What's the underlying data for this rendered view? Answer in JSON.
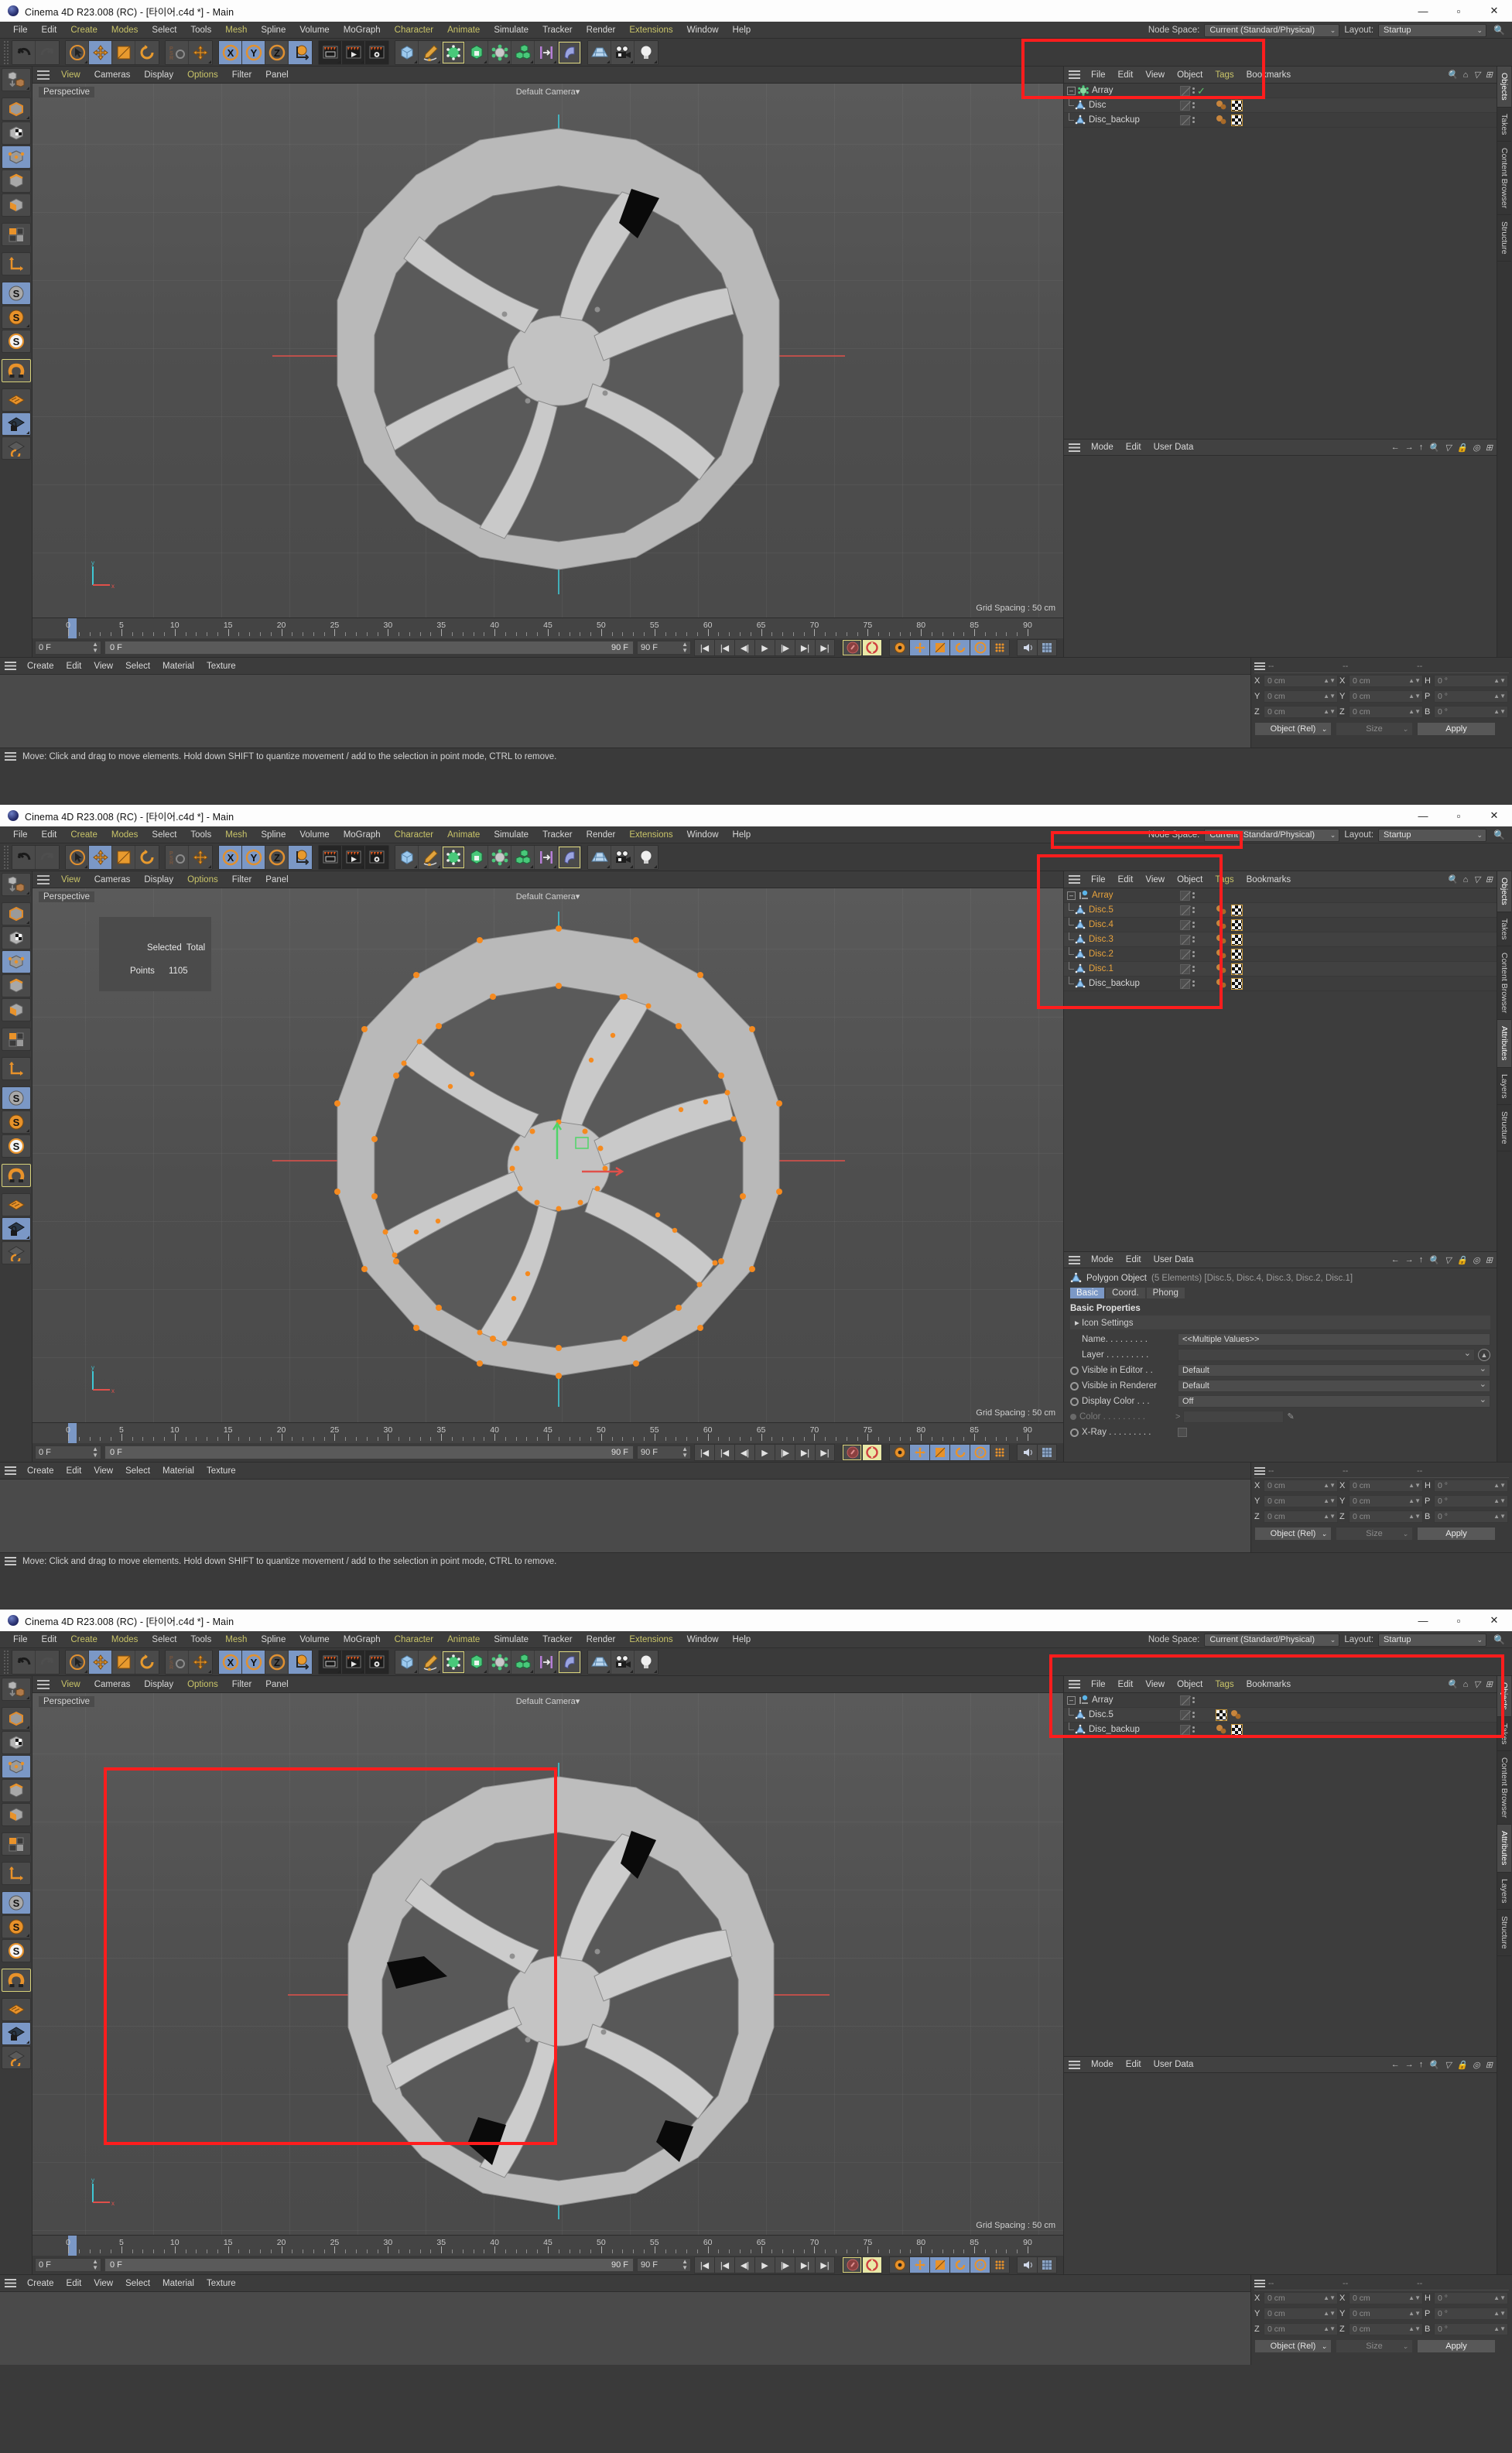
{
  "app": {
    "title": "Cinema 4D R23.008 (RC) - [타이어.c4d *] - Main",
    "win_min": "—",
    "win_max": "▫",
    "win_close": "✕"
  },
  "menu": {
    "items": [
      {
        "label": "File",
        "accent": false
      },
      {
        "label": "Edit",
        "accent": false
      },
      {
        "label": "Create",
        "accent": true
      },
      {
        "label": "Modes",
        "accent": true
      },
      {
        "label": "Select",
        "accent": false
      },
      {
        "label": "Tools",
        "accent": false
      },
      {
        "label": "Mesh",
        "accent": false
      },
      {
        "label": "Spline",
        "accent": false
      },
      {
        "label": "Volume",
        "accent": false
      },
      {
        "label": "MoGraph",
        "accent": false
      },
      {
        "label": "Character",
        "accent": false
      },
      {
        "label": "Animate",
        "accent": true
      },
      {
        "label": "Simulate",
        "accent": false
      },
      {
        "label": "Tracker",
        "accent": false
      },
      {
        "label": "Render",
        "accent": false
      },
      {
        "label": "Extensions",
        "accent": true
      },
      {
        "label": "Window",
        "accent": false
      },
      {
        "label": "Help",
        "accent": false
      }
    ],
    "node_space_label": "Node Space:",
    "node_space_value": "Current (Standard/Physical)",
    "layout_label": "Layout:",
    "layout_value": "Startup"
  },
  "viewport": {
    "menu": [
      {
        "label": "View",
        "accent": true
      },
      {
        "label": "Cameras",
        "accent": false
      },
      {
        "label": "Display",
        "accent": false
      },
      {
        "label": "Options",
        "accent": true
      },
      {
        "label": "Filter",
        "accent": false
      },
      {
        "label": "Panel",
        "accent": false
      }
    ],
    "perspective": "Perspective",
    "camera": "Default Camera▾",
    "grid_spacing": "Grid Spacing : 50 cm",
    "tooltip_header": "Selected  Total",
    "tooltip_label": "Points",
    "tooltip_value": "1105"
  },
  "object_manager": {
    "menu": [
      {
        "label": "File",
        "accent": false
      },
      {
        "label": "Edit",
        "accent": false
      },
      {
        "label": "View",
        "accent": false
      },
      {
        "label": "Object",
        "accent": false
      },
      {
        "label": "Tags",
        "accent": true
      },
      {
        "label": "Bookmarks",
        "accent": false
      }
    ],
    "panel_1_items": [
      {
        "name": "Array",
        "depth": 0,
        "icon": "array-icon",
        "selected": false,
        "tags": [
          "check"
        ]
      },
      {
        "name": "Disc",
        "depth": 1,
        "icon": "polygon-icon",
        "selected": false,
        "tags": [
          "phong",
          "checker"
        ]
      },
      {
        "name": "Disc_backup",
        "depth": 0,
        "icon": "polygon-icon",
        "selected": false,
        "tags": [
          "phong",
          "checker"
        ]
      }
    ],
    "panel_2_items": [
      {
        "name": "Array",
        "depth": 0,
        "icon": "array-icon",
        "selected": true,
        "tags": []
      },
      {
        "name": "Disc.5",
        "depth": 1,
        "icon": "polygon-icon",
        "selected": true,
        "tags": [
          "phong",
          "checker"
        ]
      },
      {
        "name": "Disc.4",
        "depth": 1,
        "icon": "polygon-icon",
        "selected": true,
        "tags": [
          "phong",
          "checker"
        ]
      },
      {
        "name": "Disc.3",
        "depth": 1,
        "icon": "polygon-icon",
        "selected": true,
        "tags": [
          "phong",
          "checker"
        ]
      },
      {
        "name": "Disc.2",
        "depth": 1,
        "icon": "polygon-icon",
        "selected": true,
        "tags": [
          "phong",
          "checker"
        ]
      },
      {
        "name": "Disc.1",
        "depth": 1,
        "icon": "polygon-icon",
        "selected": true,
        "tags": [
          "phong",
          "checker"
        ]
      },
      {
        "name": "Disc_backup",
        "depth": 0,
        "icon": "polygon-icon",
        "selected": false,
        "tags": [
          "phong",
          "checker"
        ]
      }
    ],
    "panel_3_items": [
      {
        "name": "Array",
        "depth": 0,
        "icon": "array-icon",
        "selected": false,
        "tags": []
      },
      {
        "name": "Disc.5",
        "depth": 1,
        "icon": "polygon-icon",
        "selected": false,
        "tags": [
          "checker",
          "phong"
        ]
      },
      {
        "name": "Disc_backup",
        "depth": 0,
        "icon": "polygon-icon",
        "selected": false,
        "tags": [
          "phong",
          "checker"
        ]
      }
    ]
  },
  "attributes": {
    "menu": [
      {
        "label": "Mode"
      },
      {
        "label": "Edit"
      },
      {
        "label": "User Data"
      }
    ],
    "object_title": "Polygon Object",
    "object_sub": "(5 Elements) [Disc.5, Disc.4, Disc.3, Disc.2, Disc.1]",
    "tabs": [
      {
        "label": "Basic",
        "active": true
      },
      {
        "label": "Coord.",
        "active": false
      },
      {
        "label": "Phong",
        "active": false
      }
    ],
    "section": "Basic Properties",
    "icon_settings": "Icon Settings",
    "rows": [
      {
        "label": "Name. . . . . . . . .",
        "value": "<<Multiple Values>>",
        "type": "text"
      },
      {
        "label": "Layer . . . . . . . . .",
        "value": "",
        "type": "layer"
      },
      {
        "label": "Visible in Editor . .",
        "value": "Default",
        "type": "dropdown"
      },
      {
        "label": "Visible in Renderer",
        "value": "Default",
        "type": "dropdown"
      },
      {
        "label": "Display Color . . .",
        "value": "Off",
        "type": "dropdown"
      },
      {
        "label": "Color . . . . . . . . .",
        "value": "",
        "type": "color",
        "dim": true
      },
      {
        "label": "X-Ray . . . . . . . . .",
        "value": "",
        "type": "checkbox"
      }
    ]
  },
  "right_tabs": [
    {
      "label": "Objects",
      "active": true
    },
    {
      "label": "Takes",
      "active": false
    },
    {
      "label": "Content Browser",
      "active": false
    },
    {
      "label": "Structure",
      "active": false
    }
  ],
  "right_tabs_lower": [
    {
      "label": "Attributes",
      "active": true
    },
    {
      "label": "Layers",
      "active": false
    },
    {
      "label": "Structure",
      "active": false
    }
  ],
  "timeline": {
    "ticks": [
      0,
      5,
      10,
      15,
      20,
      25,
      30,
      35,
      40,
      45,
      50,
      55,
      60,
      65,
      70,
      75,
      80,
      85,
      90
    ],
    "current_frame": "0 F",
    "range_start": "0 F",
    "range_end": "90 F",
    "preview_end": "90 F"
  },
  "material_manager": {
    "menu": [
      {
        "label": "Create"
      },
      {
        "label": "Edit"
      },
      {
        "label": "View"
      },
      {
        "label": "Select"
      },
      {
        "label": "Material"
      },
      {
        "label": "Texture"
      }
    ]
  },
  "coordinates": {
    "headers": [
      "--",
      "--",
      "--"
    ],
    "position": [
      {
        "axis": "X",
        "value": "0 cm"
      },
      {
        "axis": "Y",
        "value": "0 cm"
      },
      {
        "axis": "Z",
        "value": "0 cm"
      }
    ],
    "size": [
      {
        "axis": "X",
        "value": "0 cm"
      },
      {
        "axis": "Y",
        "value": "0 cm"
      },
      {
        "axis": "Z",
        "value": "0 cm"
      }
    ],
    "rotation": [
      {
        "axis": "H",
        "value": "0 °"
      },
      {
        "axis": "P",
        "value": "0 °"
      },
      {
        "axis": "B",
        "value": "0 °"
      }
    ],
    "mode_select": "Object (Rel)",
    "size_select": "Size",
    "apply": "Apply"
  },
  "status": {
    "message": "Move: Click and drag to move elements. Hold down SHIFT to quantize movement / add to the selection in point mode, CTRL to remove."
  },
  "colors": {
    "annotation": "#ff1d1d",
    "accent_yellow": "#c9c469",
    "selection_orange": "#e8a33d",
    "active_blue": "#7b98c6",
    "panel_bg": "#3a3a3a",
    "viewport_bg": "#535353"
  }
}
